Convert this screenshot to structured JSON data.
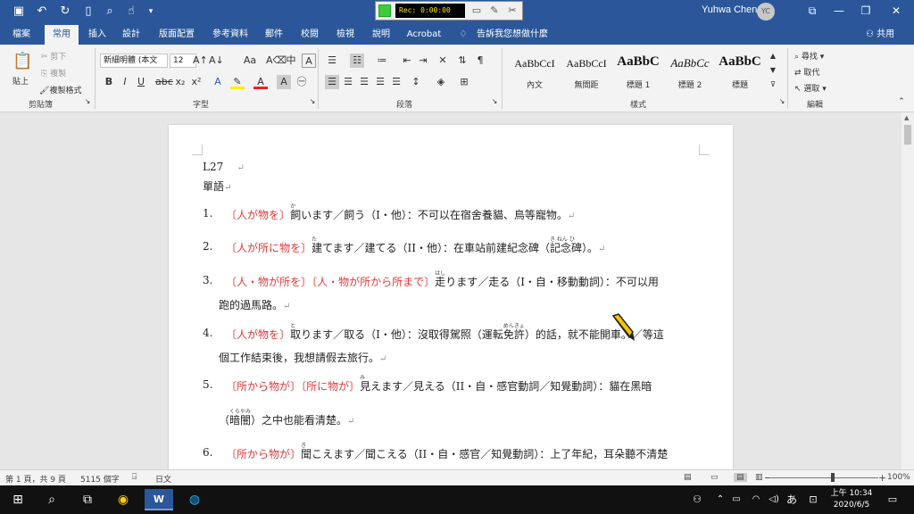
{
  "titlebar": {
    "user_name": "Yuhwa Chen",
    "user_initials": "YC",
    "recorder_text": "Rec: 0:00:00"
  },
  "tabs": [
    "檔案",
    "常用",
    "插入",
    "設計",
    "版面配置",
    "參考資料",
    "郵件",
    "校閱",
    "檢視",
    "說明",
    "Acrobat",
    "告訴我您想做什麼"
  ],
  "share_label": "共用",
  "ribbon": {
    "clipboard": {
      "paste": "貼上",
      "cut": "剪下",
      "copy": "複製",
      "format_painter": "複製格式",
      "label": "剪貼簿"
    },
    "font": {
      "name": "新細明體 (本文",
      "size": "12",
      "label": "字型"
    },
    "paragraph": {
      "label": "段落"
    },
    "styles": {
      "label": "樣式",
      "items": [
        {
          "sample": "AaBbCcI",
          "name": "內文"
        },
        {
          "sample": "AaBbCcI",
          "name": "無間距"
        },
        {
          "sample": "AaBbC",
          "name": "標題 1"
        },
        {
          "sample": "AaBbCc",
          "name": "標題 2"
        },
        {
          "sample": "AaBbC",
          "name": "標題"
        }
      ]
    },
    "editing": {
      "find": "尋找",
      "replace": "取代",
      "select": "選取",
      "label": "編輯"
    }
  },
  "document": {
    "heading": "L27",
    "subheading": "單語",
    "items": [
      {
        "num": "1.",
        "p1": "〔人",
        "p1r": "が",
        "p2": "物",
        "p2r": "を",
        "p3": "〕",
        "ruby_base": "飼",
        "ruby_text": "か",
        "rest": "います／飼う（I・他）：不可以在宿舍養貓、鳥等寵物。"
      },
      {
        "num": "2.",
        "p1": "〔人",
        "p1r": "が",
        "p2": "所",
        "p2r": "に",
        "p3": "物",
        "p3r": "を",
        "p4": "〕",
        "ruby_base": "建",
        "ruby_text": "た",
        "rest": "てます／建てる（II・他）：在車站前建紀念碑（",
        "ruby2_base": "記念碑",
        "ruby2_text": "き ねん ひ",
        "rest2": "）。"
      },
      {
        "num": "3.",
        "line1_a": "〔人・物",
        "line1_ar": "が",
        "line1_b": "所",
        "line1_br": "を",
        "line1_c": "〕〔人・物",
        "line1_cr": "が",
        "line1_d": "所",
        "line1_dr": "から",
        "line1_e": "所",
        "line1_er": "まで",
        "line1_f": "〕",
        "ruby_base": "走",
        "ruby_text": "はし",
        "rest": "ります／走る（I・自・移動動詞）：不可以用",
        "line2": "跑的過馬路。"
      },
      {
        "num": "4.",
        "p1": "〔人",
        "p1r": "が",
        "p2": "物",
        "p2r": "を",
        "p3": "〕",
        "ruby_base": "取",
        "ruby_text": "と",
        "rest": "ります／取る（I・他）：沒取得駕照（運転",
        "ruby2_base": "免許",
        "ruby2_text": "めんきょ",
        "rest2": "）的話，就不能開車。／等這",
        "line2": "個工作結束後，我想請假去旅行。"
      },
      {
        "num": "5.",
        "p1": "〔所",
        "p1r": "から",
        "p2": "物",
        "p2r": "が",
        "p3": "〕〔所",
        "p3r": "に",
        "p4": "物",
        "p4r": "が",
        "p5": "〕",
        "ruby_base": "見",
        "ruby_text": "み",
        "rest": "えます／見える（II・自・感官動詞／知覺動詞）：貓在黑暗",
        "line2_open": "（",
        "ruby2_base": "暗闇",
        "ruby2_text": "くらやみ",
        "line2": "）之中也能看清楚。"
      },
      {
        "num": "6.",
        "p1": "〔所",
        "p1r": "から",
        "p2": "物",
        "p2r": "が",
        "p3": "〕",
        "ruby_base": "聞",
        "ruby_text": "き",
        "rest": "こえます／聞こえる（II・自・感官／知覺動詞）：上了年紀，耳朵聽不清楚"
      }
    ]
  },
  "status": {
    "page": "第 1 頁，共 9 頁",
    "words": "5115 個字",
    "lang": "日文",
    "zoom": "100%"
  },
  "taskbar": {
    "time": "上午 10:34",
    "date": "2020/6/5",
    "ime": "あ"
  }
}
